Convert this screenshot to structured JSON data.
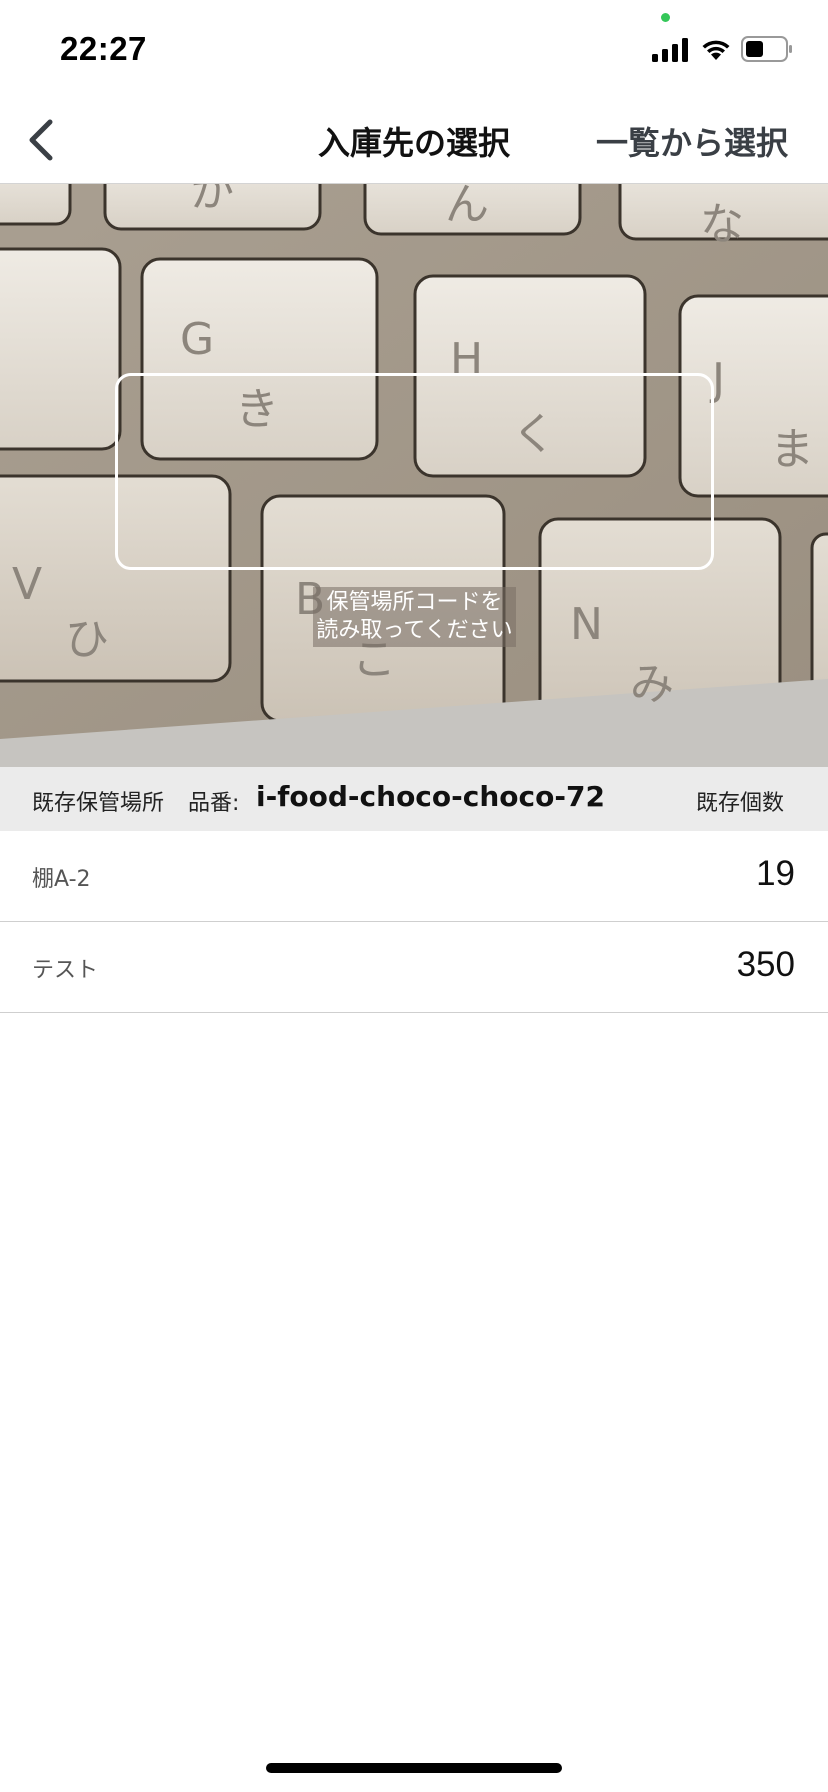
{
  "status_bar": {
    "time": "22:27",
    "icons": [
      "signal-icon",
      "wifi-icon",
      "battery-icon"
    ]
  },
  "nav": {
    "back_icon": "chevron-left-icon",
    "title": "入庫先の選択",
    "right_action": "一覧から選択"
  },
  "scanner": {
    "hint_line1": "保管場所コードを",
    "hint_line2": "読み取ってください"
  },
  "list_header": {
    "location_label": "既存保管場所",
    "part_label": "品番:",
    "part_number": "i-food-choco-choco-72",
    "count_label": "既存個数"
  },
  "locations": [
    {
      "name": "棚A-2",
      "quantity": "19"
    },
    {
      "name": "テスト",
      "quantity": "350"
    }
  ],
  "colors": {
    "header_bg": "#ebebeb",
    "privacy_dot": "#34c759",
    "action_text": "#3a3f45"
  }
}
